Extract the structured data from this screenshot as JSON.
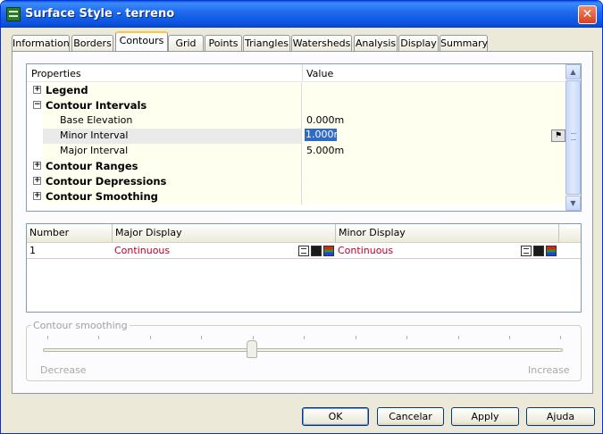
{
  "window": {
    "title": "Surface Style - terreno",
    "close_label": "✕"
  },
  "tabs": [
    {
      "label": "Information"
    },
    {
      "label": "Borders"
    },
    {
      "label": "Contours"
    },
    {
      "label": "Grid"
    },
    {
      "label": "Points"
    },
    {
      "label": "Triangles"
    },
    {
      "label": "Watersheds"
    },
    {
      "label": "Analysis"
    },
    {
      "label": "Display"
    },
    {
      "label": "Summary"
    }
  ],
  "active_tab": "Contours",
  "property_grid": {
    "columns": {
      "name": "Properties",
      "value": "Value"
    },
    "rows": [
      {
        "name": "Legend",
        "value": "",
        "expander": "+"
      },
      {
        "name": "Contour Intervals",
        "value": "",
        "expander": "−"
      },
      {
        "name": "Base Elevation",
        "value": "0.000m"
      },
      {
        "name": "Minor Interval",
        "value": "1.000m"
      },
      {
        "name": "Major Interval",
        "value": "5.000m"
      },
      {
        "name": "Contour Ranges",
        "value": "",
        "expander": "+"
      },
      {
        "name": "Contour Depressions",
        "value": "",
        "expander": "+"
      },
      {
        "name": "Contour Smoothing",
        "value": "",
        "expander": "+"
      }
    ],
    "edit_button_glyph": "⚑"
  },
  "display_list": {
    "columns": {
      "number": "Number",
      "major": "Major Display",
      "minor": "Minor Display"
    },
    "rows": [
      {
        "number": "1",
        "major": "Continuous",
        "minor": "Continuous"
      }
    ]
  },
  "smoothing": {
    "title": "Contour smoothing",
    "min_label": "Decrease",
    "max_label": "Increase",
    "level": 0.4
  },
  "buttons": {
    "ok": "OK",
    "cancel": "Cancelar",
    "apply": "Apply",
    "help": "Ajuda"
  },
  "scrollbar": {
    "up": "▲",
    "down": "▼"
  },
  "colors": {
    "accent": "#316ac5",
    "linetype": "#b8002e",
    "titlebar": "#0a50dc"
  }
}
